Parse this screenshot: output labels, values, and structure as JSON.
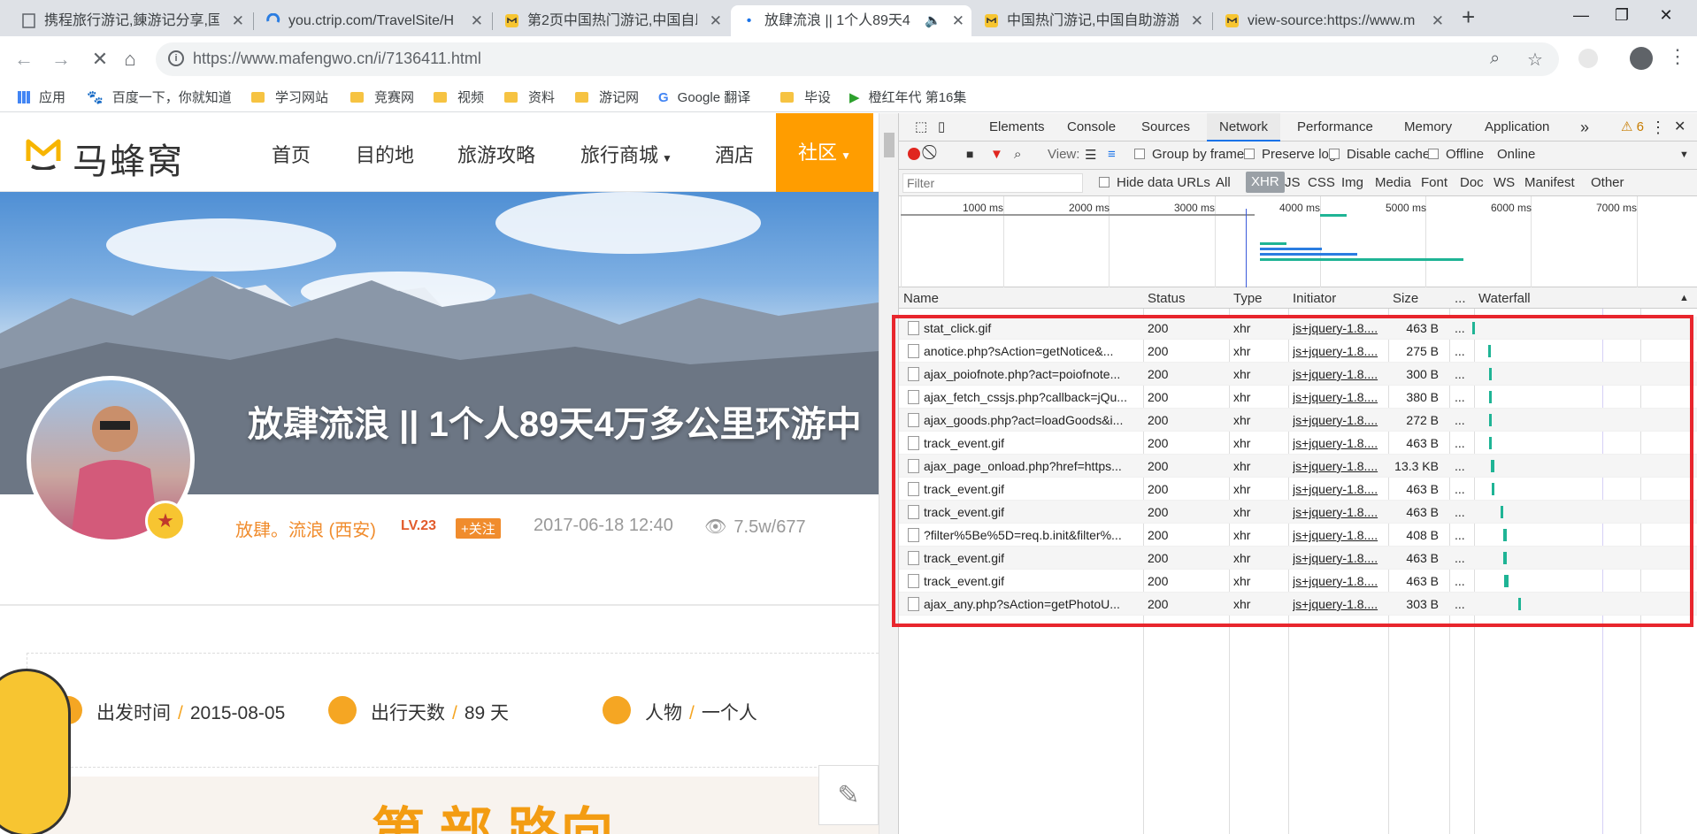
{
  "browser": {
    "tabs": [
      {
        "title": "携程旅行游记,錬游记分享,国",
        "active": false
      },
      {
        "title": "you.ctrip.com/TravelSite/H",
        "active": false
      },
      {
        "title": "第2页中国热门游记,中国自助",
        "active": false
      },
      {
        "title": "放肆流浪 || 1个人89天4",
        "active": true
      },
      {
        "title": "中国热门游记,中国自助游游",
        "active": false
      },
      {
        "title": "view-source:https://www.m",
        "active": false
      }
    ],
    "url": "https://www.mafengwo.cn/i/7136411.html",
    "bookmarks": [
      "应用",
      "百度一下，你就知道",
      "学习网站",
      "竞赛网",
      "视频",
      "资料",
      "游记网",
      "Google 翻译",
      "毕设",
      "橙红年代 第16集"
    ]
  },
  "site": {
    "logo_text": "马蜂窝",
    "nav": [
      "首页",
      "目的地",
      "旅游攻略",
      "旅行商城",
      "酒店",
      "社区"
    ],
    "title": "放肆流浪 || 1个人89天4万多公里环游中",
    "author": "放肆。流浪 (西安)",
    "level": "LV.23",
    "follow": "+关注",
    "date": "2017-06-18 12:40",
    "views": "7.5w/677",
    "facts": [
      {
        "label": "出发时间",
        "value": "2015-08-05"
      },
      {
        "label": "出行天数",
        "value": "89 天"
      },
      {
        "label": "人物",
        "value": "一个人"
      }
    ],
    "map_text": "第  部  路向"
  },
  "devtools": {
    "tabs": [
      "Elements",
      "Console",
      "Sources",
      "Network",
      "Performance",
      "Memory",
      "Application"
    ],
    "active_tab": "Network",
    "warning_count": "6",
    "toolbar": {
      "view": "View:",
      "group": "Group by frame",
      "preserve": "Preserve log",
      "disable": "Disable cache",
      "offline": "Offline",
      "throttle": "Online"
    },
    "filter_placeholder": "Filter",
    "hide_data_urls": "Hide data URLs",
    "types": [
      "All",
      "XHR",
      "JS",
      "CSS",
      "Img",
      "Media",
      "Font",
      "Doc",
      "WS",
      "Manifest",
      "Other"
    ],
    "active_type": "XHR",
    "timeline_ticks": [
      "1000 ms",
      "2000 ms",
      "3000 ms",
      "4000 ms",
      "5000 ms",
      "6000 ms",
      "7000 ms"
    ],
    "columns": [
      "Name",
      "Status",
      "Type",
      "Initiator",
      "Size",
      "...",
      "Waterfall"
    ],
    "requests": [
      {
        "name": "stat_click.gif",
        "status": "200",
        "type": "xhr",
        "initiator": "js+jquery-1.8....",
        "size": "463 B",
        "more": "..."
      },
      {
        "name": "anotice.php?sAction=getNotice&...",
        "status": "200",
        "type": "xhr",
        "initiator": "js+jquery-1.8....",
        "size": "275 B",
        "more": "..."
      },
      {
        "name": "ajax_poiofnote.php?act=poiofnote...",
        "status": "200",
        "type": "xhr",
        "initiator": "js+jquery-1.8....",
        "size": "300 B",
        "more": "..."
      },
      {
        "name": "ajax_fetch_cssjs.php?callback=jQu...",
        "status": "200",
        "type": "xhr",
        "initiator": "js+jquery-1.8....",
        "size": "380 B",
        "more": "..."
      },
      {
        "name": "ajax_goods.php?act=loadGoods&i...",
        "status": "200",
        "type": "xhr",
        "initiator": "js+jquery-1.8....",
        "size": "272 B",
        "more": "..."
      },
      {
        "name": "track_event.gif",
        "status": "200",
        "type": "xhr",
        "initiator": "js+jquery-1.8....",
        "size": "463 B",
        "more": "..."
      },
      {
        "name": "ajax_page_onload.php?href=https...",
        "status": "200",
        "type": "xhr",
        "initiator": "js+jquery-1.8....",
        "size": "13.3 KB",
        "more": "..."
      },
      {
        "name": "track_event.gif",
        "status": "200",
        "type": "xhr",
        "initiator": "js+jquery-1.8....",
        "size": "463 B",
        "more": "..."
      },
      {
        "name": "track_event.gif",
        "status": "200",
        "type": "xhr",
        "initiator": "js+jquery-1.8....",
        "size": "463 B",
        "more": "..."
      },
      {
        "name": "?filter%5Be%5D=req.b.init&filter%...",
        "status": "200",
        "type": "xhr",
        "initiator": "js+jquery-1.8....",
        "size": "408 B",
        "more": "..."
      },
      {
        "name": "track_event.gif",
        "status": "200",
        "type": "xhr",
        "initiator": "js+jquery-1.8....",
        "size": "463 B",
        "more": "..."
      },
      {
        "name": "track_event.gif",
        "status": "200",
        "type": "xhr",
        "initiator": "js+jquery-1.8....",
        "size": "463 B",
        "more": "..."
      },
      {
        "name": "ajax_any.php?sAction=getPhotoU...",
        "status": "200",
        "type": "xhr",
        "initiator": "js+jquery-1.8....",
        "size": "303 B",
        "more": "..."
      }
    ]
  },
  "colors": {
    "brand_orange": "#ff9d00",
    "highlight_red": "#e8262d",
    "waterfall_green": "#1fb495",
    "devtools_blue": "#1a73e8"
  }
}
